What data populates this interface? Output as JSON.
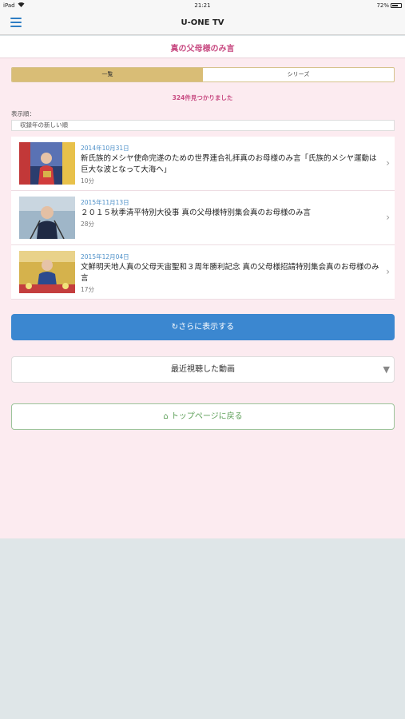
{
  "status_bar": {
    "carrier": "iPad",
    "time": "21:21",
    "battery": "72%",
    "battery_level": 0.72
  },
  "nav": {
    "title": "U-ONE TV"
  },
  "subheader": {
    "title": "真の父母様のみ言"
  },
  "tabs": [
    {
      "label": "一覧",
      "active": true
    },
    {
      "label": "シリーズ",
      "active": false
    }
  ],
  "result_count": "324件見つかりました",
  "sort": {
    "label": "表示順：",
    "value": "収録年の新しい順"
  },
  "videos": [
    {
      "date": "2014年10月31日",
      "title": "新氏族的メシヤ使命完遂のための世界連合礼拝真のお母様のみ言「氏族的メシヤ運動は巨大な波となって大海へ」",
      "duration": "10分"
    },
    {
      "date": "2015年11月13日",
      "title": "２０１５秋季清平特別大役事 真の父母様特別集会真のお母様のみ言",
      "duration": "28分"
    },
    {
      "date": "2015年12月04日",
      "title": "文鮮明天地人真の父母天宙聖和３周年勝利記念 真の父母様招請特別集会真のお母様のみ言",
      "duration": "17分"
    }
  ],
  "buttons": {
    "more_icon": "refresh-icon",
    "more": "さらに表示する",
    "recent": "最近視聴した動画",
    "top_icon": "home-icon",
    "top": "トップページに戻る"
  },
  "colors": {
    "accent_pink": "#c84b82",
    "primary_blue": "#3b87d0",
    "tab_gold": "#d9bd76",
    "background_pink": "#fcebf0"
  }
}
